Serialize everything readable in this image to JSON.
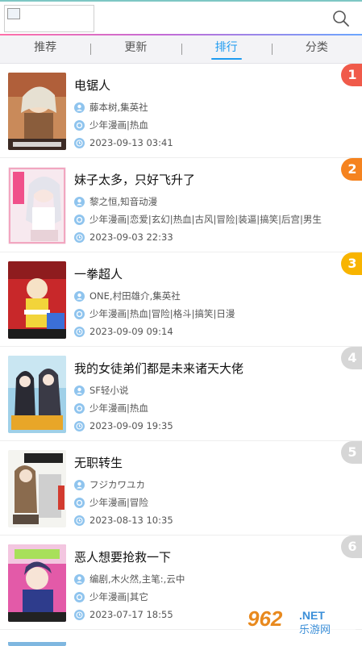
{
  "tabs": [
    {
      "label": "推荐",
      "active": false
    },
    {
      "label": "更新",
      "active": false
    },
    {
      "label": "排行",
      "active": true
    },
    {
      "label": "分类",
      "active": false
    }
  ],
  "accent_color": "#1e9bf0",
  "items": [
    {
      "rank": "1",
      "rank_color": "#f05a4a",
      "title": "电锯人",
      "author": "藤本树,集英社",
      "tags": "少年漫画|热血",
      "time": "2023-09-13 03:41"
    },
    {
      "rank": "2",
      "rank_color": "#f5831f",
      "title": "妹子太多，只好飞升了",
      "author": "黎之恒,知音动漫",
      "tags": "少年漫画|恋爱|玄幻|热血|古风|冒险|装逼|搞笑|后宫|男生",
      "time": "2023-09-03 22:33"
    },
    {
      "rank": "3",
      "rank_color": "#f8b400",
      "title": "一拳超人",
      "author": "ONE,村田雄介,集英社",
      "tags": "少年漫画|热血|冒险|格斗|搞笑|日漫",
      "time": "2023-09-09 09:14"
    },
    {
      "rank": "4",
      "rank_color": "#d6d6d6",
      "title": "我的女徒弟们都是未来诸天大佬",
      "author": "SF轻小说",
      "tags": "少年漫画|热血",
      "time": "2023-09-09 19:35"
    },
    {
      "rank": "5",
      "rank_color": "#d6d6d6",
      "title": "无职转生",
      "author": "フジカワユカ",
      "tags": "少年漫画|冒险",
      "time": "2023-08-13 10:35"
    },
    {
      "rank": "6",
      "rank_color": "#d6d6d6",
      "title": "恶人想要抢救一下",
      "author": "编剧,木火然,主笔:,云中",
      "tags": "少年漫画|其它",
      "time": "2023-07-17 18:55"
    }
  ],
  "watermark": {
    "text": "962",
    "suffix": ".NET",
    "sub": "乐游网"
  }
}
